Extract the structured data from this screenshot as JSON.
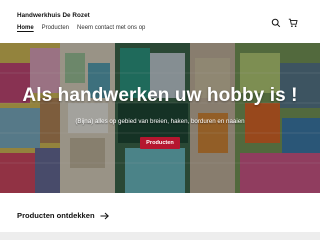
{
  "header": {
    "brand": "Handwerkhuis De Rozet",
    "nav": [
      {
        "label": "Home",
        "active": true
      },
      {
        "label": "Producten",
        "active": false
      },
      {
        "label": "Neem contact met ons op",
        "active": false
      }
    ],
    "icons": [
      "search-icon",
      "cart-icon"
    ]
  },
  "hero": {
    "title": "Als handwerken uw hobby is !",
    "subtitle": "(Bijna) alles op gebied van breien, haken, borduren en naaien",
    "button_label": "Producten",
    "button_color": "#b5162f"
  },
  "section": {
    "title": "Producten ontdekken",
    "icon": "arrow-right-icon"
  }
}
